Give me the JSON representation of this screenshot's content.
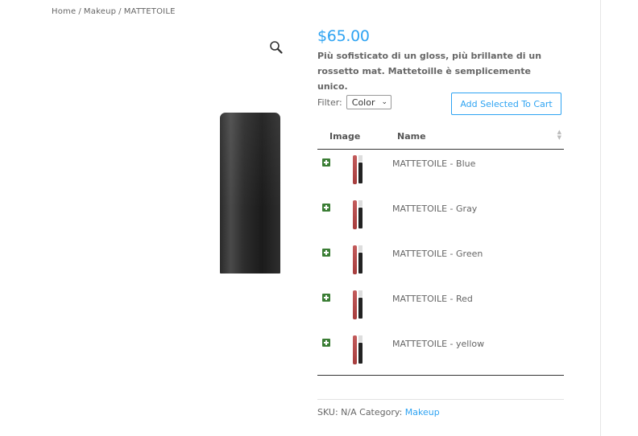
{
  "breadcrumb": {
    "items": [
      "Home",
      "Makeup",
      "MATTETOILE"
    ],
    "separator": "/"
  },
  "gallery": {
    "zoom_icon": "magnifier-icon"
  },
  "product": {
    "price": "$65.00",
    "description": "Più sofisticato di un gloss, più brillante di un rossetto mat. Mattetoille è semplicemente unico."
  },
  "filter": {
    "label": "Filter:",
    "selected": "Color"
  },
  "add_to_cart_label": "Add Selected To Cart",
  "table": {
    "headers": {
      "image": "Image",
      "name": "Name"
    },
    "rows": [
      {
        "name": "MATTETOILE - Blue"
      },
      {
        "name": "MATTETOILE - Gray"
      },
      {
        "name": "MATTETOILE - Green"
      },
      {
        "name": "MATTETOILE - Red"
      },
      {
        "name": "MATTETOILE - yellow"
      }
    ]
  },
  "meta": {
    "sku_label": "SKU:",
    "sku_value": "N/A",
    "category_label": "Category:",
    "category_value": "Makeup"
  },
  "colors": {
    "accent": "#2ea3f2",
    "expand_green": "#3a7d34",
    "text": "#666666"
  }
}
